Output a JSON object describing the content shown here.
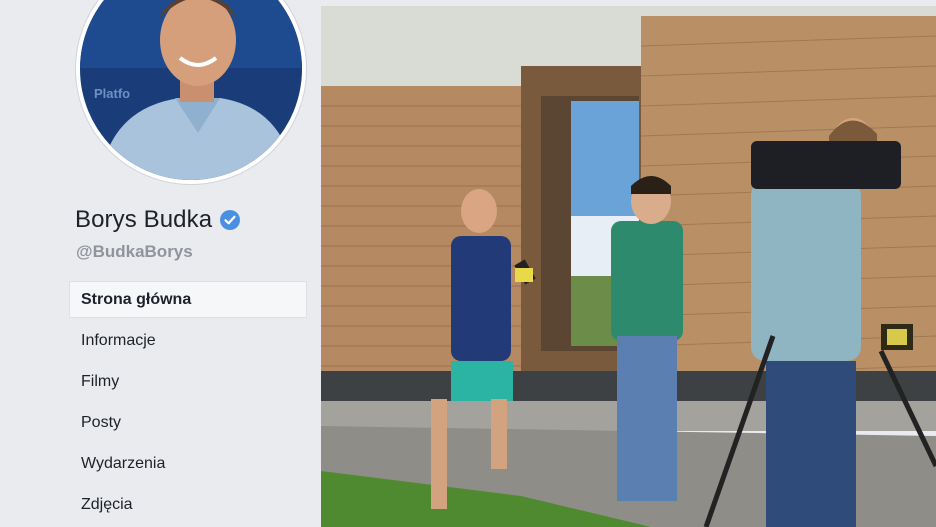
{
  "profile": {
    "name": "Borys Budka",
    "handle": "@BudkaBorys",
    "verified": true,
    "verified_color": "#4a90e2"
  },
  "nav": {
    "items": [
      {
        "label": "Strona główna",
        "active": true
      },
      {
        "label": "Informacje",
        "active": false
      },
      {
        "label": "Filmy",
        "active": false
      },
      {
        "label": "Posty",
        "active": false
      },
      {
        "label": "Wydarzenia",
        "active": false
      },
      {
        "label": "Zdjęcia",
        "active": false
      }
    ]
  },
  "photo": {
    "icon": "cover-photo"
  }
}
